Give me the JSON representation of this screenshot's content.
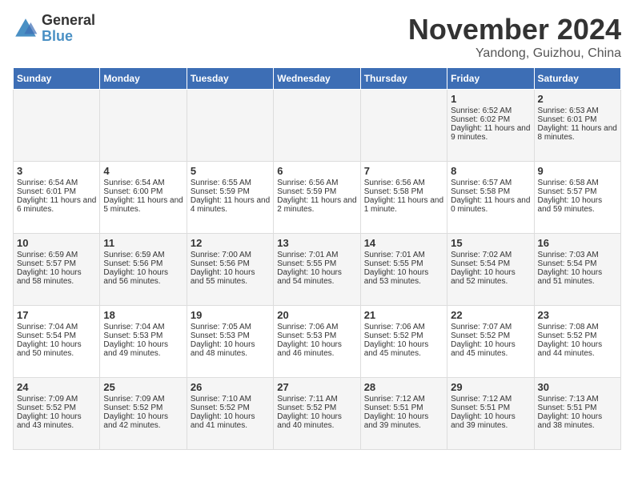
{
  "header": {
    "logo_general": "General",
    "logo_blue": "Blue",
    "month_title": "November 2024",
    "location": "Yandong, Guizhou, China"
  },
  "weekdays": [
    "Sunday",
    "Monday",
    "Tuesday",
    "Wednesday",
    "Thursday",
    "Friday",
    "Saturday"
  ],
  "weeks": [
    [
      {
        "day": "",
        "text": ""
      },
      {
        "day": "",
        "text": ""
      },
      {
        "day": "",
        "text": ""
      },
      {
        "day": "",
        "text": ""
      },
      {
        "day": "",
        "text": ""
      },
      {
        "day": "1",
        "text": "Sunrise: 6:52 AM\nSunset: 6:02 PM\nDaylight: 11 hours and 9 minutes."
      },
      {
        "day": "2",
        "text": "Sunrise: 6:53 AM\nSunset: 6:01 PM\nDaylight: 11 hours and 8 minutes."
      }
    ],
    [
      {
        "day": "3",
        "text": "Sunrise: 6:54 AM\nSunset: 6:01 PM\nDaylight: 11 hours and 6 minutes."
      },
      {
        "day": "4",
        "text": "Sunrise: 6:54 AM\nSunset: 6:00 PM\nDaylight: 11 hours and 5 minutes."
      },
      {
        "day": "5",
        "text": "Sunrise: 6:55 AM\nSunset: 5:59 PM\nDaylight: 11 hours and 4 minutes."
      },
      {
        "day": "6",
        "text": "Sunrise: 6:56 AM\nSunset: 5:59 PM\nDaylight: 11 hours and 2 minutes."
      },
      {
        "day": "7",
        "text": "Sunrise: 6:56 AM\nSunset: 5:58 PM\nDaylight: 11 hours and 1 minute."
      },
      {
        "day": "8",
        "text": "Sunrise: 6:57 AM\nSunset: 5:58 PM\nDaylight: 11 hours and 0 minutes."
      },
      {
        "day": "9",
        "text": "Sunrise: 6:58 AM\nSunset: 5:57 PM\nDaylight: 10 hours and 59 minutes."
      }
    ],
    [
      {
        "day": "10",
        "text": "Sunrise: 6:59 AM\nSunset: 5:57 PM\nDaylight: 10 hours and 58 minutes."
      },
      {
        "day": "11",
        "text": "Sunrise: 6:59 AM\nSunset: 5:56 PM\nDaylight: 10 hours and 56 minutes."
      },
      {
        "day": "12",
        "text": "Sunrise: 7:00 AM\nSunset: 5:56 PM\nDaylight: 10 hours and 55 minutes."
      },
      {
        "day": "13",
        "text": "Sunrise: 7:01 AM\nSunset: 5:55 PM\nDaylight: 10 hours and 54 minutes."
      },
      {
        "day": "14",
        "text": "Sunrise: 7:01 AM\nSunset: 5:55 PM\nDaylight: 10 hours and 53 minutes."
      },
      {
        "day": "15",
        "text": "Sunrise: 7:02 AM\nSunset: 5:54 PM\nDaylight: 10 hours and 52 minutes."
      },
      {
        "day": "16",
        "text": "Sunrise: 7:03 AM\nSunset: 5:54 PM\nDaylight: 10 hours and 51 minutes."
      }
    ],
    [
      {
        "day": "17",
        "text": "Sunrise: 7:04 AM\nSunset: 5:54 PM\nDaylight: 10 hours and 50 minutes."
      },
      {
        "day": "18",
        "text": "Sunrise: 7:04 AM\nSunset: 5:53 PM\nDaylight: 10 hours and 49 minutes."
      },
      {
        "day": "19",
        "text": "Sunrise: 7:05 AM\nSunset: 5:53 PM\nDaylight: 10 hours and 48 minutes."
      },
      {
        "day": "20",
        "text": "Sunrise: 7:06 AM\nSunset: 5:53 PM\nDaylight: 10 hours and 46 minutes."
      },
      {
        "day": "21",
        "text": "Sunrise: 7:06 AM\nSunset: 5:52 PM\nDaylight: 10 hours and 45 minutes."
      },
      {
        "day": "22",
        "text": "Sunrise: 7:07 AM\nSunset: 5:52 PM\nDaylight: 10 hours and 45 minutes."
      },
      {
        "day": "23",
        "text": "Sunrise: 7:08 AM\nSunset: 5:52 PM\nDaylight: 10 hours and 44 minutes."
      }
    ],
    [
      {
        "day": "24",
        "text": "Sunrise: 7:09 AM\nSunset: 5:52 PM\nDaylight: 10 hours and 43 minutes."
      },
      {
        "day": "25",
        "text": "Sunrise: 7:09 AM\nSunset: 5:52 PM\nDaylight: 10 hours and 42 minutes."
      },
      {
        "day": "26",
        "text": "Sunrise: 7:10 AM\nSunset: 5:52 PM\nDaylight: 10 hours and 41 minutes."
      },
      {
        "day": "27",
        "text": "Sunrise: 7:11 AM\nSunset: 5:52 PM\nDaylight: 10 hours and 40 minutes."
      },
      {
        "day": "28",
        "text": "Sunrise: 7:12 AM\nSunset: 5:51 PM\nDaylight: 10 hours and 39 minutes."
      },
      {
        "day": "29",
        "text": "Sunrise: 7:12 AM\nSunset: 5:51 PM\nDaylight: 10 hours and 39 minutes."
      },
      {
        "day": "30",
        "text": "Sunrise: 7:13 AM\nSunset: 5:51 PM\nDaylight: 10 hours and 38 minutes."
      }
    ]
  ]
}
